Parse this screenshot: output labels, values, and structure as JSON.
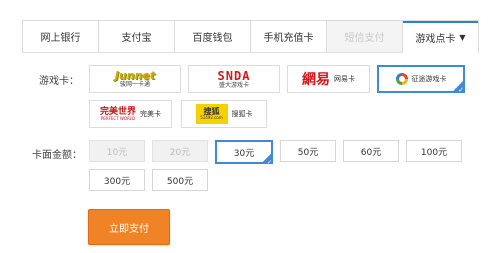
{
  "tabs": [
    {
      "label": "网上银行",
      "state": "normal"
    },
    {
      "label": "支付宝",
      "state": "normal"
    },
    {
      "label": "百度钱包",
      "state": "normal"
    },
    {
      "label": "手机充值卡",
      "state": "normal"
    },
    {
      "label": "短信支付",
      "state": "disabled"
    },
    {
      "label": "游戏点卡",
      "state": "active"
    }
  ],
  "game_card": {
    "label": "游戏卡：",
    "cards": [
      {
        "logo": "Junnet",
        "caption": "骏网一卡通",
        "selected": false
      },
      {
        "logo": "SNDA",
        "caption": "盛大游戏卡",
        "selected": false
      },
      {
        "logo": "網易",
        "caption": "网易卡",
        "selected": false
      },
      {
        "logo": "征途",
        "caption": "征途游戏卡",
        "selected": true
      },
      {
        "logo": "完美世界",
        "caption": "完美卡",
        "selected": false
      },
      {
        "logo": "搜狐",
        "caption": "搜狐卡",
        "selected": false
      }
    ]
  },
  "amount": {
    "label": "卡面金额：",
    "options": [
      {
        "value": "10元",
        "state": "disabled"
      },
      {
        "value": "20元",
        "state": "disabled"
      },
      {
        "value": "30元",
        "state": "selected"
      },
      {
        "value": "50元",
        "state": "normal"
      },
      {
        "value": "60元",
        "state": "normal"
      },
      {
        "value": "100元",
        "state": "normal"
      },
      {
        "value": "300元",
        "state": "normal"
      },
      {
        "value": "500元",
        "state": "normal"
      }
    ]
  },
  "pay_button": "立即支付",
  "colors": {
    "accent": "#3d8ad8",
    "pay_button": "#f08326",
    "disabled_bg": "#f1f1f1"
  }
}
